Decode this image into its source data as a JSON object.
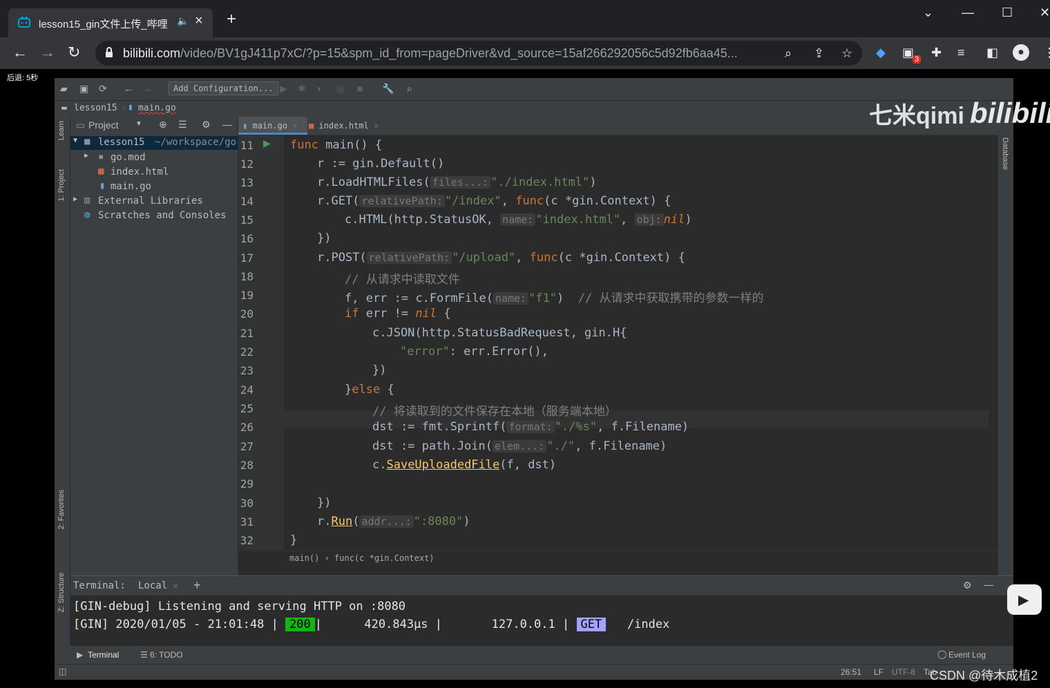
{
  "browser": {
    "tab_title": "lesson15_gin文件上传_哔哩",
    "url_host": "bilibili.com",
    "url_path": "/video/BV1gJ411p7xC/?p=15&spm_id_from=pageDriver&vd_source=15af266292056c5d92fb6aa45...",
    "ext_badge": "3"
  },
  "video": {
    "skip_text": "后退: 5秒",
    "watermark_text": "七米qimi",
    "watermark_logo": "bilibili",
    "csdn_text": "CSDN @待木成植2"
  },
  "ide": {
    "toolbar": {
      "add_configuration": "Add Configuration..."
    },
    "breadcrumb": [
      "lesson15",
      "main.go"
    ],
    "left_strip": {
      "learn": "Learn",
      "project": "1: Project",
      "favorites": "2: Favorites",
      "structure": "Z: Structure"
    },
    "right_strip": {
      "database": "Database"
    },
    "project": {
      "header": "Project",
      "root_name": "lesson15",
      "root_path": "~/workspace/go",
      "items": [
        "go.mod",
        "index.html",
        "main.go",
        "External Libraries",
        "Scratches and Consoles"
      ]
    },
    "editor_tabs": [
      "main.go",
      "index.html"
    ],
    "line_numbers": [
      "11",
      "12",
      "13",
      "14",
      "15",
      "16",
      "17",
      "18",
      "19",
      "20",
      "21",
      "22",
      "23",
      "24",
      "25",
      "26",
      "27",
      "28",
      "29",
      "30",
      "31",
      "32"
    ],
    "code": {
      "l11_a": "func",
      "l11_b": " main() {",
      "l12": "r := gin.Default()",
      "l13_a": "r.LoadHTMLFiles(",
      "l13_h": "files...:",
      "l13_s": "\"./index.html\"",
      "l13_e": ")",
      "l14_a": "r.GET(",
      "l14_h": "relativePath:",
      "l14_s": "\"/index\"",
      "l14_c": ", ",
      "l14_k": "func",
      "l14_e": "(c *gin.Context) {",
      "l15_a": "c.HTML(http.StatusOK, ",
      "l15_h1": "name:",
      "l15_s": "\"index.html\"",
      "l15_c": ", ",
      "l15_h2": "obj:",
      "l15_k": "nil",
      "l15_e": ")",
      "l16": "})",
      "l17_a": "r.POST(",
      "l17_h": "relativePath:",
      "l17_s": "\"/upload\"",
      "l17_c": ", ",
      "l17_k": "func",
      "l17_e": "(c *gin.Context) {",
      "l18": "// 从请求中读取文件",
      "l19_a": "f, err := c.FormFile(",
      "l19_h": "name:",
      "l19_s": "\"f1\"",
      "l19_e": ")  ",
      "l19_cmt": "// 从请求中获取携带的参数一样的",
      "l20_k": "if",
      "l20_a": " err != ",
      "l20_n": "nil",
      "l20_e": " {",
      "l21": "c.JSON(http.StatusBadRequest, gin.H{",
      "l22_s": "\"error\"",
      "l22_e": ": err.Error(),",
      "l23": "})",
      "l24_a": "}",
      "l24_k": "else",
      "l24_e": " {",
      "l25": "// 将读取到的文件保存在本地（服务端本地）",
      "l26_a": "dst := fmt.Sprintf(",
      "l26_h": "format:",
      "l26_s": "\"./%s\"",
      "l26_e": ", f.Filename)",
      "l27_a": "dst := path.Join(",
      "l27_h": "elem...:",
      "l27_s": "\"./\"",
      "l27_e": ", f.Filename)",
      "l28_a": "c.",
      "l28_f": "SaveUploadedFile",
      "l28_e": "(f, dst)",
      "l30": "})",
      "l31_a": "r.",
      "l31_f": "Run",
      "l31_b": "(",
      "l31_h": "addr...:",
      "l31_s": "\":8080\"",
      "l31_e": ")",
      "l32": "}"
    },
    "code_breadcrumb": "main() › func(c *gin.Context)",
    "terminal": {
      "label": "Terminal:",
      "tab": "Local",
      "line1": "[GIN-debug] Listening and serving HTTP on :8080",
      "line2_a": "[GIN] 2020/01/05 - 21:01:48 |",
      "status": "200",
      "line2_b": "|      420.843µs |       127.0.0.1 |",
      "method": "GET",
      "path": "/index"
    },
    "bottom_tabs": {
      "terminal": "Terminal",
      "todo": "6: TODO",
      "event_log": "Event Log"
    },
    "status": {
      "position": "26:51",
      "line_sep": "LF",
      "encoding": "UTF-8",
      "indent": "Tab"
    }
  }
}
